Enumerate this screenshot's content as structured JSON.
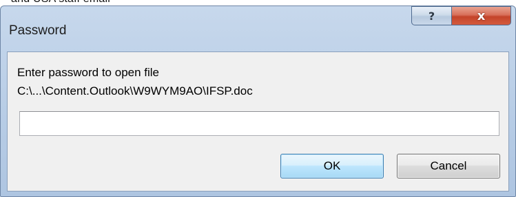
{
  "background": {
    "partial_text": "and USA staff email"
  },
  "dialog": {
    "title": "Password",
    "help_glyph": "?",
    "close_glyph": "x",
    "prompt": "Enter password to open file",
    "file_path": "C:\\...\\Content.Outlook\\W9WYM9AO\\IFSP.doc",
    "password_value": "",
    "ok_label": "OK",
    "cancel_label": "Cancel"
  },
  "colors": {
    "close_button": "#c4442a",
    "ok_border": "#3c7fb1",
    "frame": "#b8cde6"
  }
}
